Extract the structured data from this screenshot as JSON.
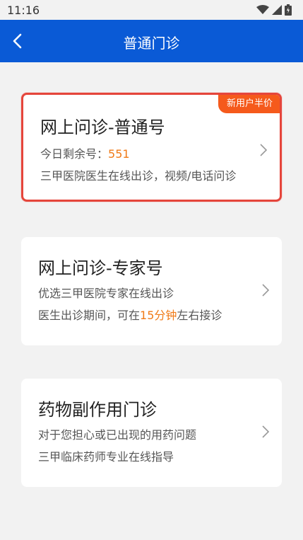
{
  "status": {
    "time": "11:16"
  },
  "header": {
    "title": "普通门诊"
  },
  "cards": [
    {
      "title": "网上问诊-普通号",
      "badge": "新用户半价",
      "line1_prefix": "今日剩余号：",
      "line1_value": "551",
      "line2": "三甲医院医生在线出诊，视频/电话问诊"
    },
    {
      "title": "网上问诊-专家号",
      "line1": "优选三甲医院专家在线出诊",
      "line2_prefix": "医生出诊期间，可在",
      "line2_highlight": "15分钟",
      "line2_suffix": "左右接诊"
    },
    {
      "title": "药物副作用门诊",
      "line1": "对于您担心或已出现的用药问题",
      "line2": "三甲临床药师专业在线指导"
    }
  ],
  "colors": {
    "header": "#0a5ad6",
    "accent": "#f07a17",
    "badge": "#f55a1c",
    "highlight_border": "#e5453b"
  },
  "icons": {
    "back": "chevron-left-icon",
    "card_arrow": "chevron-right-icon"
  }
}
